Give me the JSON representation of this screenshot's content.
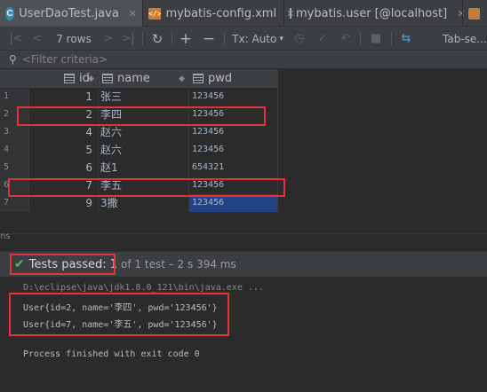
{
  "tabs": [
    {
      "label": "UserDaoTest.java",
      "icon": "class-icon",
      "active": true
    },
    {
      "label": "mybatis-config.xml",
      "icon": "xml-icon",
      "active": false
    },
    {
      "label": "mybatis.user [@localhost]",
      "icon": "table-icon",
      "active": false
    }
  ],
  "toolbar": {
    "rows_label": "7 rows",
    "tx_label": "Tx: Auto",
    "tab_label": "Tab-se..."
  },
  "filter": {
    "placeholder": "<Filter criteria>"
  },
  "grid": {
    "columns": [
      "id",
      "name",
      "pwd"
    ],
    "rows": [
      {
        "num": "1",
        "id": "1",
        "name": "张三",
        "pwd": "123456"
      },
      {
        "num": "2",
        "id": "2",
        "name": "李四",
        "pwd": "123456"
      },
      {
        "num": "3",
        "id": "4",
        "name": "赵六",
        "pwd": "123456"
      },
      {
        "num": "4",
        "id": "5",
        "name": "赵六",
        "pwd": "123456"
      },
      {
        "num": "5",
        "id": "6",
        "name": "赵1",
        "pwd": "654321"
      },
      {
        "num": "6",
        "id": "7",
        "name": "李五",
        "pwd": "123456"
      },
      {
        "num": "7",
        "id": "9",
        "name": "3撒",
        "pwd": "123456"
      }
    ]
  },
  "run": {
    "gutter_label": "ns",
    "gutter_label2": "ns",
    "tests_passed": "Tests passed: 1",
    "rest": "of 1 test – 2 s 394 ms"
  },
  "console": {
    "cmd": "D:\\eclipse\\java\\jdk1.8.0_121\\bin\\java.exe ...",
    "out1": "User{id=2, name='李四', pwd='123456'}",
    "out2": "User{id=7, name='李五', pwd='123456'}",
    "finish": "Process finished with exit code 0"
  },
  "colors": {
    "highlight_box": "#e0333b",
    "selection": "#214283",
    "pass": "#5fb85f"
  }
}
